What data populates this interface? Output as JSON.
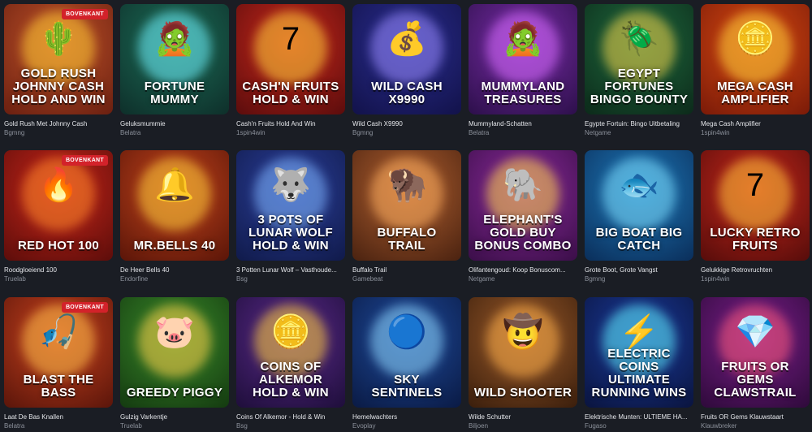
{
  "badge_label": "BOVENKANT",
  "games": [
    {
      "title": "Gold Rush Met Johnny Cash",
      "provider": "Bgmng",
      "logo": "Gold Rush Johnny Cash Hold and Win",
      "icon": "cowboy-cactus-icon",
      "art": "🌵",
      "badge": true,
      "bg": [
        "#c0532a",
        "#6a1f10"
      ],
      "glow": "#ffcc33"
    },
    {
      "title": "Geluksmummie",
      "provider": "Belatra",
      "logo": "Fortune Mummy",
      "icon": "mummy-icon",
      "art": "🧟",
      "badge": false,
      "bg": [
        "#1c6d57",
        "#0e2f2a"
      ],
      "glow": "#6ff2ff"
    },
    {
      "title": "Cash'n Fruits Hold And Win",
      "provider": "1spin4win",
      "logo": "Cash'n Fruits Hold & Win",
      "icon": "lucky-seven-icon",
      "art": "7",
      "badge": false,
      "bg": [
        "#c8281c",
        "#5a0c0c"
      ],
      "glow": "#ffd23a"
    },
    {
      "title": "Wild Cash X9990",
      "provider": "Bgmng",
      "logo": "Wild Cash X9990",
      "icon": "coin-icon",
      "art": "💰",
      "badge": false,
      "bg": [
        "#2a2d8e",
        "#12124a"
      ],
      "glow": "#9a8bff"
    },
    {
      "title": "Mummyland-Schatten",
      "provider": "Belatra",
      "logo": "Mummyland Treasures",
      "icon": "mummy-icon",
      "art": "🧟",
      "badge": false,
      "bg": [
        "#7a2da8",
        "#2c0f4a"
      ],
      "glow": "#d86bff"
    },
    {
      "title": "Egypte Fortuin: Bingo Uitbetaling",
      "provider": "Netgame",
      "logo": "Egypt Fortunes Bingo Bounty",
      "icon": "scarab-icon",
      "art": "🪲",
      "badge": false,
      "bg": [
        "#1f6a3e",
        "#0c2a1a"
      ],
      "glow": "#f2d24a"
    },
    {
      "title": "Mega Cash Amplifier",
      "provider": "1spin4win",
      "logo": "Mega Cash Amplifier",
      "icon": "coin-icon",
      "art": "🪙",
      "badge": false,
      "bg": [
        "#d84a12",
        "#7a1a08"
      ],
      "glow": "#ffd43a"
    },
    {
      "title": "Roodgloeiend 100",
      "provider": "Truelab",
      "logo": "Red Hot 100",
      "icon": "fire-icon",
      "art": "🔥",
      "badge": true,
      "bg": [
        "#c8261a",
        "#5c0d0a"
      ],
      "glow": "#ff8a2a"
    },
    {
      "title": "De Heer Bells 40",
      "provider": "Endorfine",
      "logo": "Mr.Bells 40",
      "icon": "bell-icon",
      "art": "🔔",
      "badge": false,
      "bg": [
        "#c2441c",
        "#5a1508"
      ],
      "glow": "#ffcf3a"
    },
    {
      "title": "3 Potten Lunar Wolf – Vasthoude...",
      "provider": "Bsg",
      "logo": "3 Pots of Lunar Wolf Hold & Win",
      "icon": "wolf-icon",
      "art": "🐺",
      "badge": false,
      "bg": [
        "#2b3f9a",
        "#101a4a"
      ],
      "glow": "#7fb6ff"
    },
    {
      "title": "Buffalo Trail",
      "provider": "Gamebeat",
      "logo": "Buffalo Trail",
      "icon": "buffalo-icon",
      "art": "🦬",
      "badge": false,
      "bg": [
        "#b06030",
        "#4a2210"
      ],
      "glow": "#ffb060"
    },
    {
      "title": "Olifantengoud: Koop Bonuscom...",
      "provider": "Netgame",
      "logo": "Elephant's Gold Buy Bonus Combo",
      "icon": "elephant-icon",
      "art": "🐘",
      "badge": false,
      "bg": [
        "#8a2a9a",
        "#3a0e48"
      ],
      "glow": "#ffd54a"
    },
    {
      "title": "Grote Boot, Grote Vangst",
      "provider": "Bgmng",
      "logo": "Big Boat Big Catch",
      "icon": "fish-icon",
      "art": "🐟",
      "badge": false,
      "bg": [
        "#1e78b8",
        "#0a2e5a"
      ],
      "glow": "#7fe0ff"
    },
    {
      "title": "Gelukkige Retrovruchten",
      "provider": "1spin4win",
      "logo": "Lucky Retro Fruits",
      "icon": "lucky-seven-icon",
      "art": "7",
      "badge": false,
      "bg": [
        "#c6281c",
        "#560c0a"
      ],
      "glow": "#ffc53a"
    },
    {
      "title": "Laat De Bas Knallen",
      "provider": "Belatra",
      "logo": "Blast the Bass",
      "icon": "fisherman-icon",
      "art": "🎣",
      "badge": true,
      "bg": [
        "#c8421e",
        "#5a150a"
      ],
      "glow": "#ffc04a"
    },
    {
      "title": "Gulzig Varkentje",
      "provider": "Truelab",
      "logo": "Greedy Piggy",
      "icon": "pig-icon",
      "art": "🐷",
      "badge": false,
      "bg": [
        "#3a8a2a",
        "#143a10"
      ],
      "glow": "#ffd04a"
    },
    {
      "title": "Coins Of Alkemor - Hold & Win",
      "provider": "Bsg",
      "logo": "Coins of Alkemor Hold & Win",
      "icon": "coin-icon",
      "art": "🪙",
      "badge": false,
      "bg": [
        "#5a2a8a",
        "#1e0e3a"
      ],
      "glow": "#ffcf3a"
    },
    {
      "title": "Hemelwachters",
      "provider": "Evoplay",
      "logo": "Sky Sentinels",
      "icon": "orb-icon",
      "art": "🔵",
      "badge": false,
      "bg": [
        "#1e4a9a",
        "#0a1a44"
      ],
      "glow": "#8fd8ff"
    },
    {
      "title": "Wilde Schutter",
      "provider": "Biljoen",
      "logo": "Wild Shooter",
      "icon": "cowboy-icon",
      "art": "🤠",
      "badge": false,
      "bg": [
        "#9a5a2a",
        "#3a1e0c"
      ],
      "glow": "#ffb04a"
    },
    {
      "title": "Elektrische Munten: ULTIEME HA...",
      "provider": "Fugaso",
      "logo": "Electric Coins Ultimate Running Wins",
      "icon": "lightning-icon",
      "art": "⚡",
      "badge": false,
      "bg": [
        "#1a3a9a",
        "#0a143e"
      ],
      "glow": "#5ff0ff"
    },
    {
      "title": "Fruits OR Gems Klauwstaart",
      "provider": "Klauwbreker",
      "logo": "Fruits or Gems Clawstrail",
      "icon": "gem-icon",
      "art": "💎",
      "badge": false,
      "bg": [
        "#7a1e8a",
        "#2e0a3a"
      ],
      "glow": "#ff5a7a"
    }
  ]
}
